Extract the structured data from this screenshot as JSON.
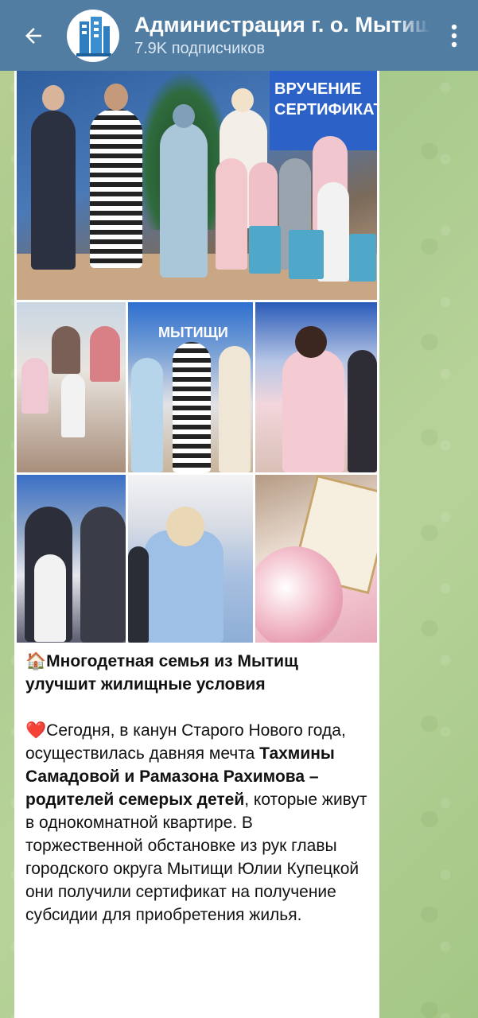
{
  "header": {
    "back_icon": "arrow-left-icon",
    "channel_title": "Администрация г. о. Мытищи",
    "subscribers": "7.9K подписчиков",
    "menu_icon": "vertical-dots-icon"
  },
  "photos": {
    "main_banner": "ВРУЧЕНИЕ СЕРТИФИКАТ",
    "photo_b_banner": "МЫТИЩИ"
  },
  "post": {
    "headline_emoji": "🏠",
    "headline": "Многодетная семья из Мытищ улучшит жилищные условия",
    "body_emoji": "❤️",
    "body_part1": "Сегодня, в канун Старого Нового года, осуществилась давняя мечта ",
    "body_bold": "Тахмины Самадовой и Рамазона Рахимова – родителей семерых детей",
    "body_part2": ", которые живут в однокомнатной квартире. В торжественной обстановке из рук главы городского округа Мытищи Юлии Купецкой они получили сертификат на получение субсидии для приобретения жилья."
  },
  "colors": {
    "topbar": "#527da3",
    "chat_background": "#b0cd90"
  }
}
